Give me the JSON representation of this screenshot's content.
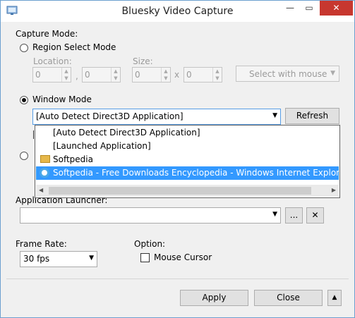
{
  "window": {
    "title": "Bluesky Video Capture",
    "min": "—",
    "max": "▭",
    "close": "✕"
  },
  "capture": {
    "heading": "Capture Mode:",
    "region_label": "Region Select Mode",
    "location_label": "Location:",
    "size_label": "Size:",
    "loc_x": "0",
    "loc_y": "0",
    "size_w": "0",
    "size_h": "0",
    "comma": ",",
    "times": "x",
    "select_mouse_label": "Select with mouse",
    "window_label": "Window Mode",
    "window_select_value": "[Auto Detect Direct3D Application]",
    "refresh_label": "Refresh"
  },
  "dropdown_items": [
    {
      "label": "[Auto Detect Direct3D Application]",
      "icon": "none"
    },
    {
      "label": "[Launched Application]",
      "icon": "none"
    },
    {
      "label": "Softpedia",
      "icon": "folder-icon"
    },
    {
      "label": "Softpedia - Free Downloads Encyclopedia - Windows Internet Explorer",
      "icon": "ie-icon",
      "selected": true
    }
  ],
  "launcher": {
    "label": "Application Launcher:",
    "value": "",
    "browse_label": "...",
    "clear_label": "✕"
  },
  "frame_rate": {
    "label": "Frame Rate:",
    "value": "30 fps"
  },
  "option": {
    "label": "Option:",
    "mouse_cursor_label": "Mouse Cursor",
    "mouse_cursor_checked": false
  },
  "footer": {
    "apply_label": "Apply",
    "close_label": "Close",
    "expand_label": "▲"
  },
  "colors": {
    "selection": "#3399ff",
    "close_button": "#c7372f",
    "window_border": "#6ca0cf"
  }
}
